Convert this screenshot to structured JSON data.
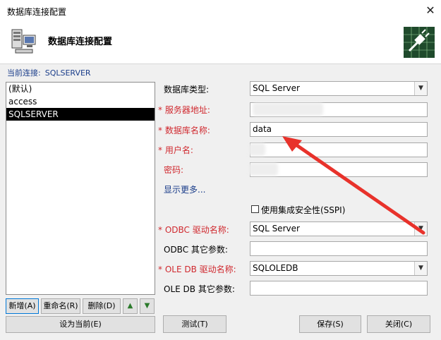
{
  "window": {
    "title": "数据库连接配置",
    "close_glyph": "✕"
  },
  "header": {
    "title": "数据库连接配置",
    "left_icon": "database-server-icon",
    "right_icon": "plug-connection-icon"
  },
  "current_connection": {
    "label": "当前连接:",
    "value": "SQLSERVER"
  },
  "connections": [
    "(默认)",
    "access",
    "SQLSERVER"
  ],
  "buttons": {
    "new": "新增(A)",
    "rename": "重命名(R)",
    "delete": "删除(D)",
    "up": "▲",
    "down": "▼",
    "set_current": "设为当前(E)",
    "test": "测试(T)",
    "save": "保存(S)",
    "close": "关闭(C)"
  },
  "form": {
    "db_type": {
      "label": "数据库类型:",
      "value": "SQL Server"
    },
    "server": {
      "label": "服务器地址:",
      "value": ""
    },
    "db_name": {
      "label": "数据库名称:",
      "value": "data"
    },
    "user": {
      "label": "用户名:",
      "value": ""
    },
    "password": {
      "label": "密码:",
      "value": ""
    },
    "show_more": "显示更多...",
    "integrated_security": {
      "label": "使用集成安全性(SSPI)",
      "checked": false
    },
    "odbc_driver": {
      "label": "ODBC 驱动名称:",
      "value": "SQL Server"
    },
    "odbc_params": {
      "label": "ODBC 其它参数:",
      "value": ""
    },
    "oledb_driver": {
      "label": "OLE DB 驱动名称:",
      "value": "SQLOLEDB"
    },
    "oledb_params": {
      "label": "OLE DB 其它参数:",
      "value": ""
    },
    "required_mark": "*"
  },
  "annotation_color": "#e8322b"
}
